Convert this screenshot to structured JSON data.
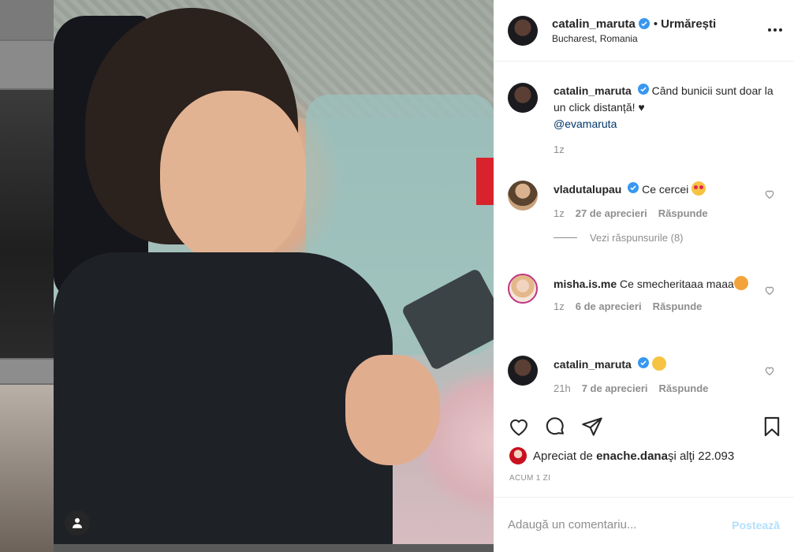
{
  "post": {
    "username": "catalin_maruta",
    "follow_status": "Urmărești",
    "location": "Bucharest, Romania",
    "caption": "Când bunicii sunt doar la un click distanță! ♥",
    "mention": "@evamaruta",
    "caption_time": "1z",
    "likes_prefix": "Apreciat de ",
    "liked_by": "enache.dana",
    "likes_suffix": " şi alţi 22.093",
    "timestamp": "ACUM 1 ZI"
  },
  "comments": [
    {
      "username": "vladutalupau",
      "text": "Ce cercei",
      "time": "1z",
      "likes": "27 de aprecieri",
      "reply": "Răspunde",
      "view_replies": "Vezi răspunsurile (8)"
    },
    {
      "username": "misha.is.me",
      "text": "Ce smecheritaaa maaa",
      "time": "1z",
      "likes": "6 de aprecieri",
      "reply": "Răspunde"
    },
    {
      "username": "catalin_maruta",
      "text": "",
      "time": "21h",
      "likes": "7 de aprecieri",
      "reply": "Răspunde"
    }
  ],
  "comment_box": {
    "placeholder": "Adaugă un comentariu...",
    "post_label": "Postează"
  },
  "colors": {
    "link": "#00376b",
    "verified": "#3897f0",
    "muted": "#8e8e8e",
    "post_disabled": "#b2dffc"
  }
}
